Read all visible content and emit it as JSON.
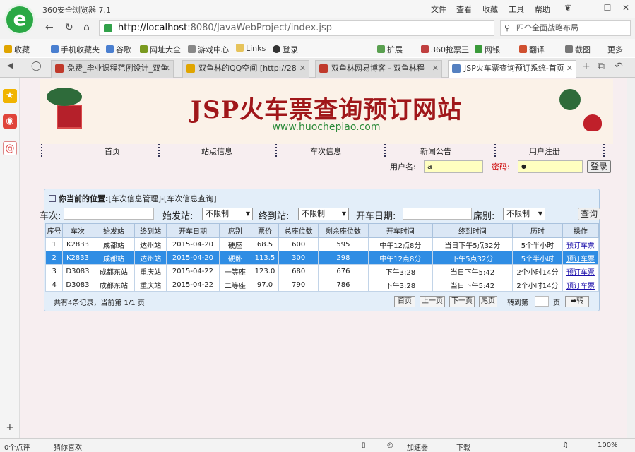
{
  "browser": {
    "app_title": "360安全浏览器 7.1",
    "menu": [
      "文件",
      "查看",
      "收藏",
      "工具",
      "帮助"
    ],
    "url_host": "http://localhost",
    "url_path": ":8080/JavaWebProject/index.jsp",
    "search_placeholder": "四个全面战略布局"
  },
  "bookmarks": [
    "收藏",
    "手机收藏夹",
    "谷歌",
    "网址大全",
    "游戏中心",
    "Links",
    "登录",
    "扩展",
    "360抢票王",
    "网银",
    "翻译",
    "截图",
    "更多"
  ],
  "tabs": [
    "免费_毕业课程范例设计_双鱼",
    "双鱼林的QQ空间 [http://28",
    "双鱼林网易博客 - 双鱼林程",
    "JSP火车票查询预订系统-首页"
  ],
  "site": {
    "title": "JSP火车票查询预订网站",
    "url": "www.huochepiao.com",
    "nav": [
      "首页",
      "站点信息",
      "车次信息",
      "新闻公告",
      "用户注册"
    ],
    "login": {
      "user_label": "用户名:",
      "user_value": "a",
      "pwd_label": "密码:",
      "pwd_value": "●",
      "button": "登录"
    }
  },
  "panel": {
    "title_bold": "你当前的位置:",
    "title_path": "[车次信息管理]-[车次信息查询]"
  },
  "filter": {
    "train_label": "车次:",
    "from_label": "始发站:",
    "from_value": "不限制",
    "to_label": "终到站:",
    "to_value": "不限制",
    "date_label": "开车日期:",
    "seat_label": "席别:",
    "seat_value": "不限制",
    "query": "查询"
  },
  "table": {
    "headers": [
      "序号",
      "车次",
      "始发站",
      "终到站",
      "开车日期",
      "席别",
      "票价",
      "总座位数",
      "剩余座位数",
      "开车时间",
      "终到时间",
      "历时",
      "操作"
    ],
    "rows": [
      [
        "1",
        "K2833",
        "成都站",
        "达州站",
        "2015-04-20",
        "硬座",
        "68.5",
        "600",
        "595",
        "中午12点8分",
        "当日下午5点32分",
        "5个半小时",
        "预订车票"
      ],
      [
        "2",
        "K2833",
        "成都站",
        "达州站",
        "2015-04-20",
        "硬卧",
        "113.5",
        "300",
        "298",
        "中午12点8分",
        "下午5点32分",
        "5个半小时",
        "预订车票"
      ],
      [
        "3",
        "D3083",
        "成都东站",
        "重庆站",
        "2015-04-22",
        "一等座",
        "123.0",
        "680",
        "676",
        "下午3:28",
        "当日下午5:42",
        "2个小时14分",
        "预订车票"
      ],
      [
        "4",
        "D3083",
        "成都东站",
        "重庆站",
        "2015-04-22",
        "二等座",
        "97.0",
        "790",
        "786",
        "下午3:28",
        "当日下午5:42",
        "2个小时14分",
        "预订车票"
      ]
    ]
  },
  "pager": {
    "summary": "共有4条记录，当前第 1/1 页",
    "first": "首页",
    "prev": "上一页",
    "next": "下一页",
    "last": "尾页",
    "goto": "转到第",
    "page_unit": "页",
    "go": "➡转"
  },
  "status": {
    "left1": "0个点评",
    "left2": "猜你喜欢",
    "accel": "加速器",
    "download": "下载",
    "zoom": "100%"
  }
}
